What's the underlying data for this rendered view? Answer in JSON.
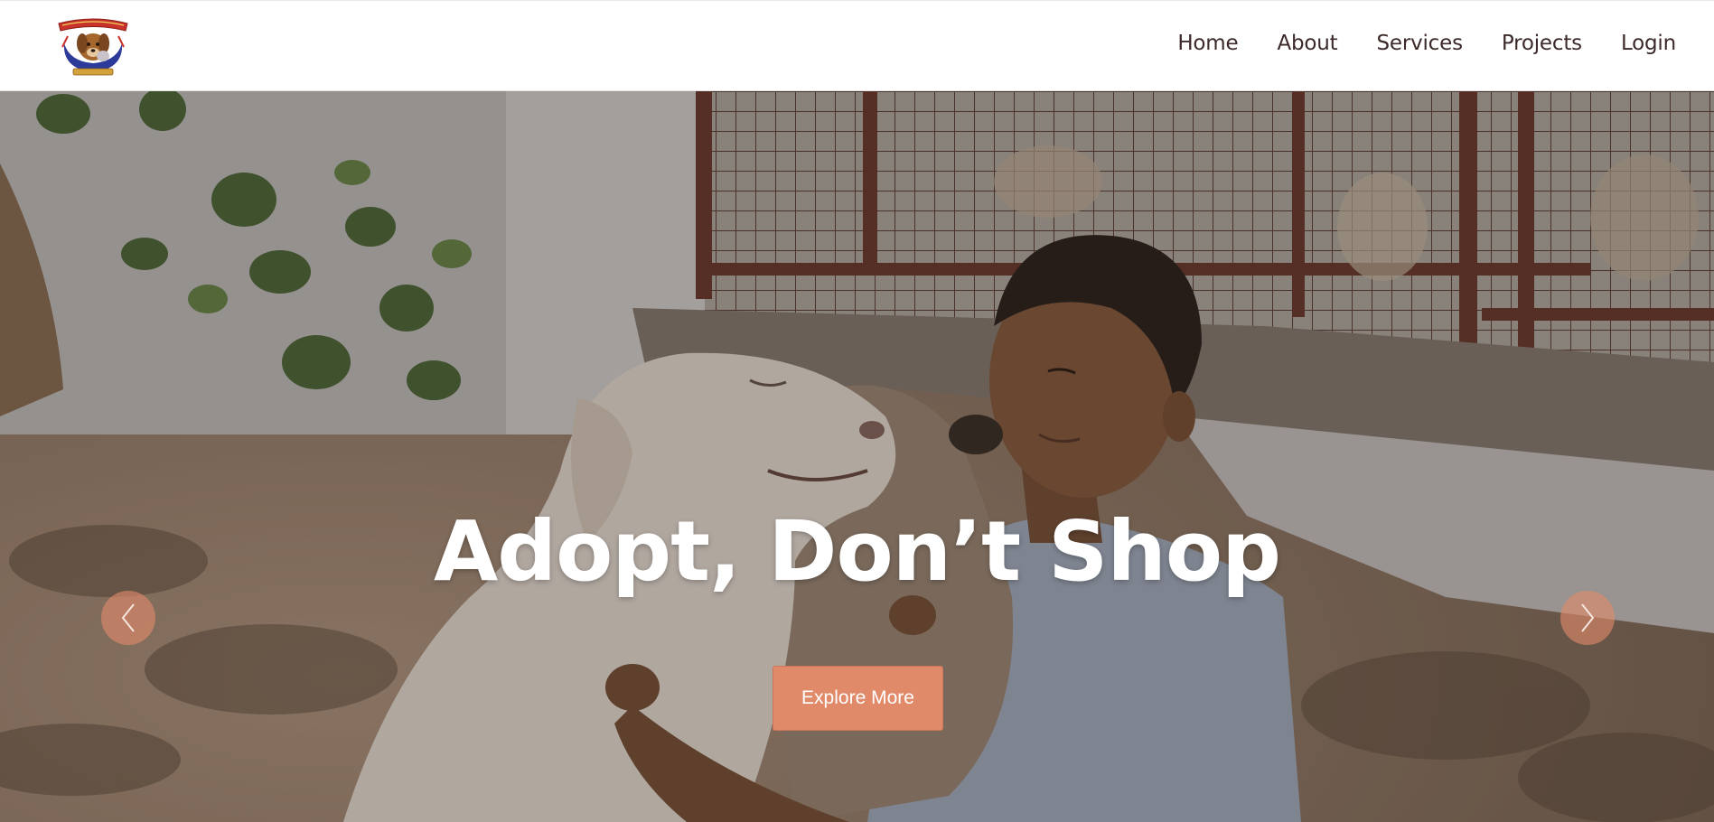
{
  "header": {
    "logo_icon": "rescue-shelter-logo",
    "nav": {
      "home": "Home",
      "about": "About",
      "services": "Services",
      "projects": "Projects",
      "login": "Login"
    }
  },
  "hero": {
    "headline": "Adopt, Don’t Shop",
    "cta_label": "Explore More",
    "prev_icon": "chevron-left-icon",
    "next_icon": "chevron-right-icon",
    "background_description_icon": "man-hugging-dogs-photo"
  },
  "colors": {
    "accent": "#e08a6a",
    "nav_text": "#3c2a2a",
    "headline": "#ffffff"
  }
}
